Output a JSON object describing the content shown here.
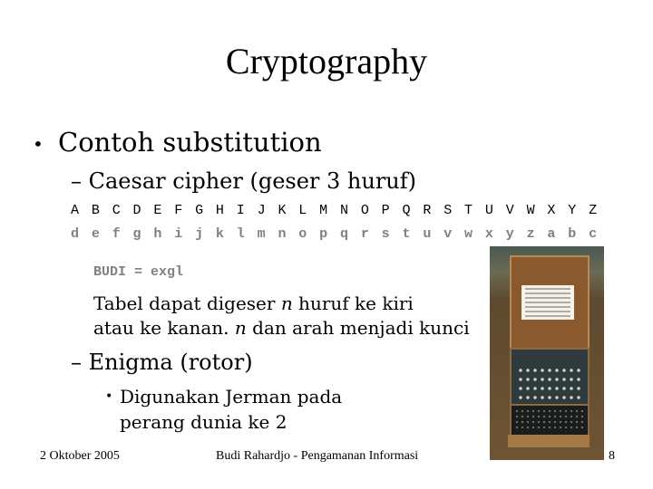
{
  "slide": {
    "title": "Cryptography",
    "bullet_1": "Contoh substitution",
    "caesar": {
      "heading": "– Caesar cipher (geser 3 huruf)",
      "plain": [
        "A",
        "B",
        "C",
        "D",
        "E",
        "F",
        "G",
        "H",
        "I",
        "J",
        "K",
        "L",
        "M",
        "N",
        "O",
        "P",
        "Q",
        "R",
        "S",
        "T",
        "U",
        "V",
        "W",
        "X",
        "Y",
        "Z"
      ],
      "cipher": [
        "d",
        "e",
        "f",
        "g",
        "h",
        "i",
        "j",
        "k",
        "l",
        "m",
        "n",
        "o",
        "p",
        "q",
        "r",
        "s",
        "t",
        "u",
        "v",
        "w",
        "x",
        "y",
        "z",
        "a",
        "b",
        "c"
      ],
      "example": "BUDI = exgl",
      "note_line1_a": "Tabel dapat digeser ",
      "note_var": "n",
      "note_line1_b": " huruf ke kiri",
      "note_line2_a": "atau ke kanan. ",
      "note_line2_b": " dan arah menjadi kunci"
    },
    "enigma": {
      "heading": "– Enigma (rotor)",
      "bullet_line1": "Digunakan Jerman pada",
      "bullet_line2": "perang dunia ke 2",
      "image_alt": "Enigma machine photo"
    },
    "footer": {
      "date": "2 Oktober 2005",
      "center": "Budi Rahardjo - Pengamanan Informasi",
      "page": "8"
    },
    "colors": {
      "cipher_text": "#808080",
      "text": "#000000"
    }
  }
}
